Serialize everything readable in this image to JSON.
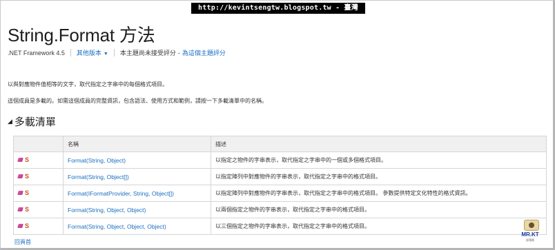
{
  "watermark": "http://kevintsengtw.blogspot.tw - 臺灣",
  "page": {
    "title": "String.Format 方法",
    "framework": ".NET Framework 4.5",
    "other_versions": "其他版本",
    "rating_text": "本主題尚未接受評分",
    "rate_link": "為這個主題評分"
  },
  "description": {
    "p1": "以與對應物件值相等的文字，取代指定之字串中的每個格式項目。",
    "p2": "這個成員是多載的。如需這個成員的完整資訊，包含語法、使用方式和範例，請按一下多載清單中的名稱。"
  },
  "section": {
    "title": "多載清單"
  },
  "table": {
    "headers": [
      "",
      "名稱",
      "描述"
    ],
    "rows": [
      {
        "icon": "public-method-static-icon",
        "name": "Format(String, Object)",
        "desc": "以指定之物件的字串表示，取代指定之字串中的一個或多個格式項目。"
      },
      {
        "icon": "public-method-static-icon",
        "name": "Format(String, Object[])",
        "desc": "以指定陣列中對應物件的字串表示，取代指定之字串中的格式項目。"
      },
      {
        "icon": "public-method-static-icon",
        "name": "Format(IFormatProvider, String, Object[])",
        "desc": "以指定陣列中對應物件的字串表示，取代指定之字串中的格式項目。 參數提供特定文化特性的格式資訊。"
      },
      {
        "icon": "public-method-static-icon",
        "name": "Format(String, Object, Object)",
        "desc": "以兩個指定之物件的字串表示，取代指定之字串中的格式項目。"
      },
      {
        "icon": "public-method-static-icon",
        "name": "Format(String, Object, Object, Object)",
        "desc": "以三個指定之物件的字串表示，取代指定之字串中的格式項目。"
      }
    ],
    "static_glyph": "S"
  },
  "footer": {
    "back_to_top": "回頁首"
  },
  "logo": {
    "brand": "MR.KT",
    "tagline": "部落格"
  },
  "colors": {
    "link": "#1a6ec0",
    "header_bg": "#f0f0f0",
    "border": "#d5d5d5",
    "static_icon": "#c8501c"
  }
}
